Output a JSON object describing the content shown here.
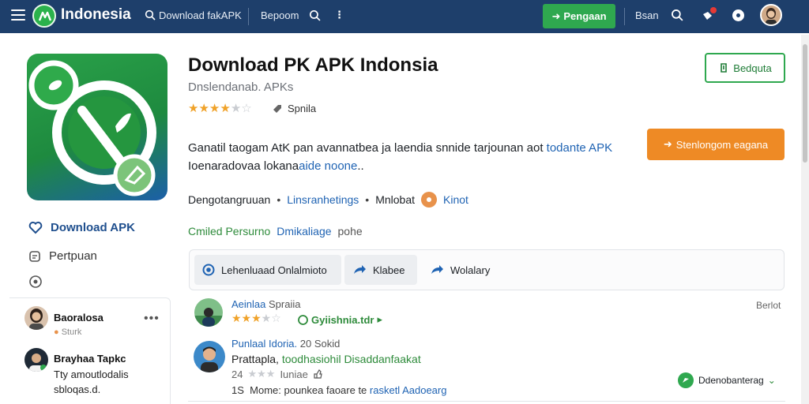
{
  "topbar": {
    "brand": "Indonesia",
    "search_text": "Download fakAPK",
    "link_1": "Bepoom",
    "button_label": "Pengaan",
    "link_2": "Bsan"
  },
  "app": {
    "title": "Download PK APK Indonsia",
    "subtitle": "Dnslendanab. APKs",
    "rating": 3.5,
    "rating_tag": "Spnila",
    "desc_line1_a": "Ganatil taogam AtK pan avannatbea ja laendia snnide tarjounan aot ",
    "desc_line1_b": "todante APK",
    "desc_line2_a": "Ioenaradovaa lokana",
    "desc_line2_b": "aide noone",
    "desc_line2_c": "..",
    "meta_a": "Dengotangruuan",
    "meta_b": "Linsranhetings",
    "meta_c": "Mnlobat",
    "meta_d": "Kinot",
    "tag_a": "Cmiled Persurno",
    "tag_b": "Dmikaliage",
    "tag_c": "pohe"
  },
  "buttons": {
    "outline_label": "Bedquta",
    "orange_label": "Stenlongom eagana"
  },
  "sidebar": {
    "item_download": "Download APK",
    "item_perpus": "Pertpuan"
  },
  "side_users": [
    {
      "name": "Baoralosa",
      "sub": "Sturk"
    },
    {
      "name": "Brayhaa Tapkc",
      "msg_line1": "Tty amoutlodalis",
      "msg_line2": "sbloqas.d."
    }
  ],
  "action_bar": {
    "btn1": "Lehenluaad Onlalmioto",
    "btn2": "Klabee",
    "btn3": "Wolalary"
  },
  "reviews": [
    {
      "name": "Aeinlaa",
      "name_extra": "Spraiia",
      "rating": 3.5,
      "badge": "Gyiishnia.tdr",
      "date": "Berlot"
    },
    {
      "name": "Punlaal Idoria.",
      "meta": "20 Sokid",
      "line1_a": "Prattapla, ",
      "line1_b": "toodhasiohil Disaddanfaakat",
      "line2_a": "24",
      "line2_b": "Iuniae",
      "line3_a": "1S",
      "line3_b": "Mome: pounkea faoare te ",
      "line3_c": "rasketl Aadoearg",
      "badge": "Ddenobanterag"
    }
  ],
  "colors": {
    "topbar": "#1e3f6b",
    "green": "#2fa84f",
    "orange": "#ee8a25",
    "link_blue": "#1f63b3",
    "star": "#f0a229"
  }
}
